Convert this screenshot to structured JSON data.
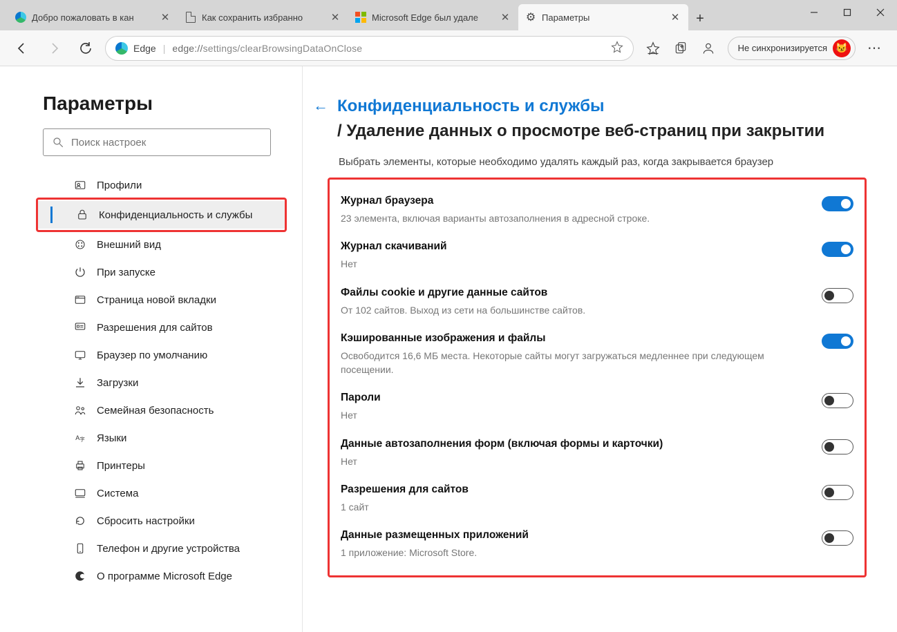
{
  "window": {
    "tabs": [
      {
        "title": "Добро пожаловать в кан",
        "favicon": "edge"
      },
      {
        "title": "Как сохранить избранно",
        "favicon": "doc"
      },
      {
        "title": "Microsoft Edge был удале",
        "favicon": "ms"
      },
      {
        "title": "Параметры",
        "favicon": "gear",
        "active": true
      }
    ]
  },
  "toolbar": {
    "site_label": "Edge",
    "url_host": "edge://",
    "url_path": "settings/clearBrowsingDataOnClose",
    "sync_label": "Не синхронизируется"
  },
  "sidebar": {
    "heading": "Параметры",
    "search_placeholder": "Поиск настроек",
    "items": [
      {
        "icon": "profile",
        "label": "Профили"
      },
      {
        "icon": "lock",
        "label": "Конфиденциальность и службы",
        "active": true
      },
      {
        "icon": "appearance",
        "label": "Внешний вид"
      },
      {
        "icon": "power",
        "label": "При запуске"
      },
      {
        "icon": "newtab",
        "label": "Страница новой вкладки"
      },
      {
        "icon": "permissions",
        "label": "Разрешения для сайтов"
      },
      {
        "icon": "default",
        "label": "Браузер по умолчанию"
      },
      {
        "icon": "download",
        "label": "Загрузки"
      },
      {
        "icon": "family",
        "label": "Семейная безопасность"
      },
      {
        "icon": "lang",
        "label": "Языки"
      },
      {
        "icon": "printer",
        "label": "Принтеры"
      },
      {
        "icon": "system",
        "label": "Система"
      },
      {
        "icon": "reset",
        "label": "Сбросить настройки"
      },
      {
        "icon": "phone",
        "label": "Телефон и другие устройства"
      },
      {
        "icon": "about",
        "label": "О программе Microsoft Edge"
      }
    ]
  },
  "main": {
    "crumb_link": "Конфиденциальность и службы",
    "crumb_sep": "/ ",
    "crumb_current": "Удаление данных о просмотре веб-страниц при закрытии",
    "intro": "Выбрать элементы, которые необходимо удалять каждый раз, когда закрывается браузер",
    "rows": [
      {
        "title": "Журнал браузера",
        "desc": "23 элемента, включая варианты автозаполнения в адресной строке.",
        "on": true
      },
      {
        "title": "Журнал скачиваний",
        "desc": "Нет",
        "on": true
      },
      {
        "title": "Файлы cookie и другие данные сайтов",
        "desc": "От 102 сайтов. Выход из сети на большинстве сайтов.",
        "on": false
      },
      {
        "title": "Кэшированные изображения и файлы",
        "desc": "Освободится 16,6 МБ места. Некоторые сайты могут загружаться медленнее при следующем посещении.",
        "on": true
      },
      {
        "title": "Пароли",
        "desc": "Нет",
        "on": false
      },
      {
        "title": "Данные автозаполнения форм (включая формы и карточки)",
        "desc": "Нет",
        "on": false
      },
      {
        "title": "Разрешения для сайтов",
        "desc": "1 сайт",
        "on": false
      },
      {
        "title": "Данные размещенных приложений",
        "desc": "1 приложение: Microsoft Store.",
        "on": false
      }
    ]
  }
}
